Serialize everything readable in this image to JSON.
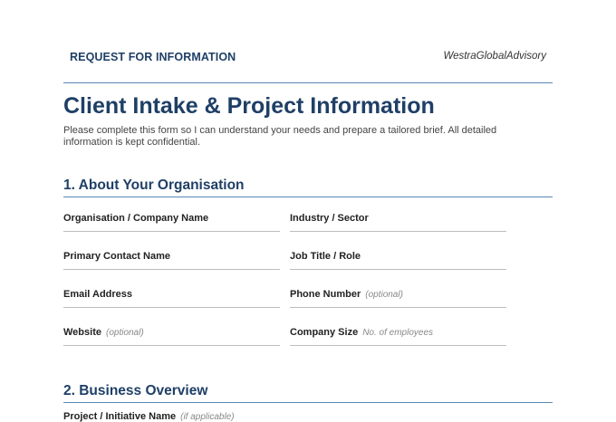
{
  "header": {
    "left": "REQUEST FOR INFORMATION",
    "right": "WestraGlobalAdvisory"
  },
  "title": "Client Intake & Project Information",
  "intro": "Please complete this form so I can understand your needs and prepare a tailored brief. All detailed information is kept confidential.",
  "sections": [
    {
      "title": "1.  About Your Organisation",
      "fields": [
        {
          "label": "Organisation / Company Name",
          "hint": ""
        },
        {
          "label": "Industry / Sector",
          "hint": ""
        },
        {
          "label": "Primary Contact Name",
          "hint": ""
        },
        {
          "label": "Job Title / Role",
          "hint": ""
        },
        {
          "label": "Email Address",
          "hint": ""
        },
        {
          "label": "Phone Number",
          "hint": "(optional)"
        },
        {
          "label": "Website",
          "hint": "(optional)"
        },
        {
          "label": "Company Size",
          "hint": "No. of employees"
        }
      ]
    },
    {
      "title": "2.  Business Overview",
      "fields": [
        {
          "label": "Project / Initiative Name",
          "hint": "(if applicable)"
        }
      ]
    }
  ]
}
